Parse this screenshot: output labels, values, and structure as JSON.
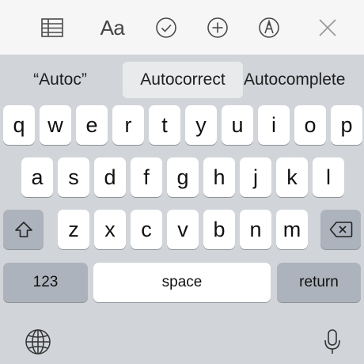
{
  "toolbar": {
    "items": [
      {
        "name": "table-icon"
      },
      {
        "name": "format-text",
        "label": "Aa"
      },
      {
        "name": "checklist-icon"
      },
      {
        "name": "add-icon"
      },
      {
        "name": "markup-pen-icon"
      },
      {
        "name": "close-icon"
      }
    ]
  },
  "suggestions": {
    "left": "“Autoc”",
    "center": "Autocorrect",
    "right": "Autocomplete"
  },
  "keyboard": {
    "row1": [
      "q",
      "w",
      "e",
      "r",
      "t",
      "y",
      "u",
      "i",
      "o",
      "p"
    ],
    "row2": [
      "a",
      "s",
      "d",
      "f",
      "g",
      "h",
      "j",
      "k",
      "l"
    ],
    "row3": [
      "z",
      "x",
      "c",
      "v",
      "b",
      "n",
      "m"
    ],
    "numbers_label": "123",
    "space_label": "space",
    "return_label": "return",
    "shift_icon": "shift-icon",
    "delete_icon": "backspace-icon",
    "globe_icon": "globe-icon",
    "mic_icon": "microphone-icon"
  },
  "colors": {
    "toolbar_bg": "#f6f6f6",
    "keyboard_bg": "#d1d4d9",
    "key_bg": "#ffffff",
    "special_key_bg": "#adb3bc"
  }
}
